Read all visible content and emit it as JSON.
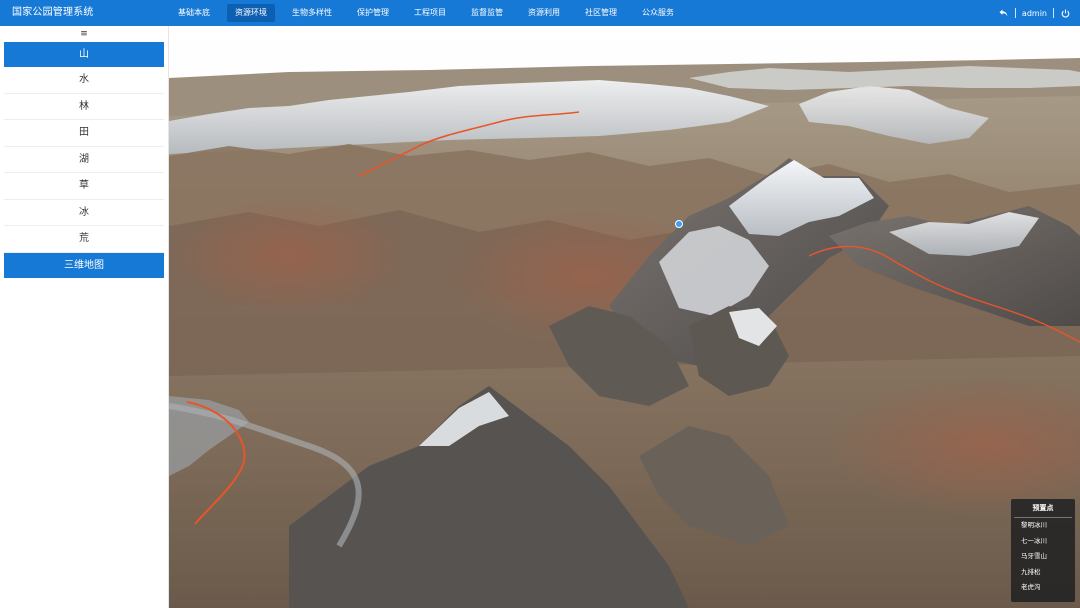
{
  "app": {
    "title": "国家公园管理系统"
  },
  "nav": {
    "items": [
      {
        "label": "基础本底"
      },
      {
        "label": "资源环境"
      },
      {
        "label": "生物多样性"
      },
      {
        "label": "保护管理"
      },
      {
        "label": "工程项目"
      },
      {
        "label": "监督监管"
      },
      {
        "label": "资源利用"
      },
      {
        "label": "社区管理"
      },
      {
        "label": "公众服务"
      }
    ],
    "active_index": 1
  },
  "user": {
    "name": "admin",
    "back_icon": "reply-icon",
    "power_icon": "power-icon"
  },
  "sidebar": {
    "collapse_icon": "menu-icon",
    "collapse_glyph": "≡",
    "items": [
      {
        "label": "山"
      },
      {
        "label": "水"
      },
      {
        "label": "林"
      },
      {
        "label": "田"
      },
      {
        "label": "湖"
      },
      {
        "label": "草"
      },
      {
        "label": "冰"
      },
      {
        "label": "荒"
      },
      {
        "label": "三维地图"
      }
    ]
  },
  "preset_panel": {
    "title": "预置点",
    "items": [
      {
        "label": "黎明冰川"
      },
      {
        "label": "七一冰川"
      },
      {
        "label": "马牙雪山"
      },
      {
        "label": "九排松"
      },
      {
        "label": "老虎沟"
      }
    ]
  },
  "colors": {
    "brand": "#1679d6",
    "nav_active": "#0d5fb2",
    "route_line": "#e8552a",
    "marker": "#3aa0ff"
  }
}
